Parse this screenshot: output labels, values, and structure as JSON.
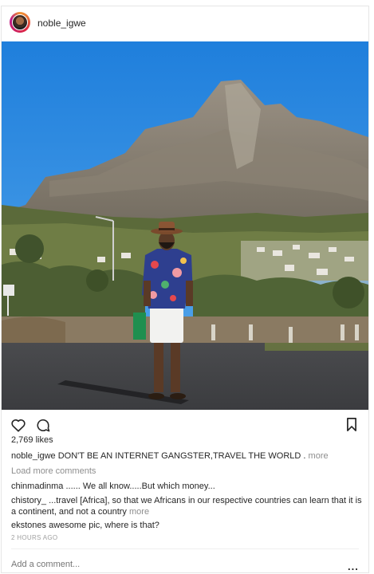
{
  "post": {
    "username": "noble_igwe",
    "likes": "2,769 likes",
    "caption": {
      "user": "noble_igwe",
      "text": "DON'T BE AN INTERNET GANGSTER,TRAVEL THE WORLD .",
      "more": "more"
    },
    "load_more": "Load more comments",
    "comments": [
      {
        "user": "chinmadinma",
        "text": "...... We all know.....But which money..."
      },
      {
        "user": "chistory_",
        "text": "...travel [Africa], so that we Africans in our respective countries can learn that it is a continent, and not a country",
        "more": "more"
      },
      {
        "user": "ekstones",
        "text": "awesome pic, where is that?"
      }
    ],
    "time_ago": "2 HOURS AGO",
    "add_comment_placeholder": "Add a comment...",
    "options_label": "..."
  },
  "icons": {
    "like": "heart-icon",
    "comment": "comment-icon",
    "save": "bookmark-icon",
    "options": "more-options-icon"
  },
  "colors": {
    "text": "#262626",
    "muted": "#8e8e8e",
    "sky": "#2f8ee3"
  }
}
